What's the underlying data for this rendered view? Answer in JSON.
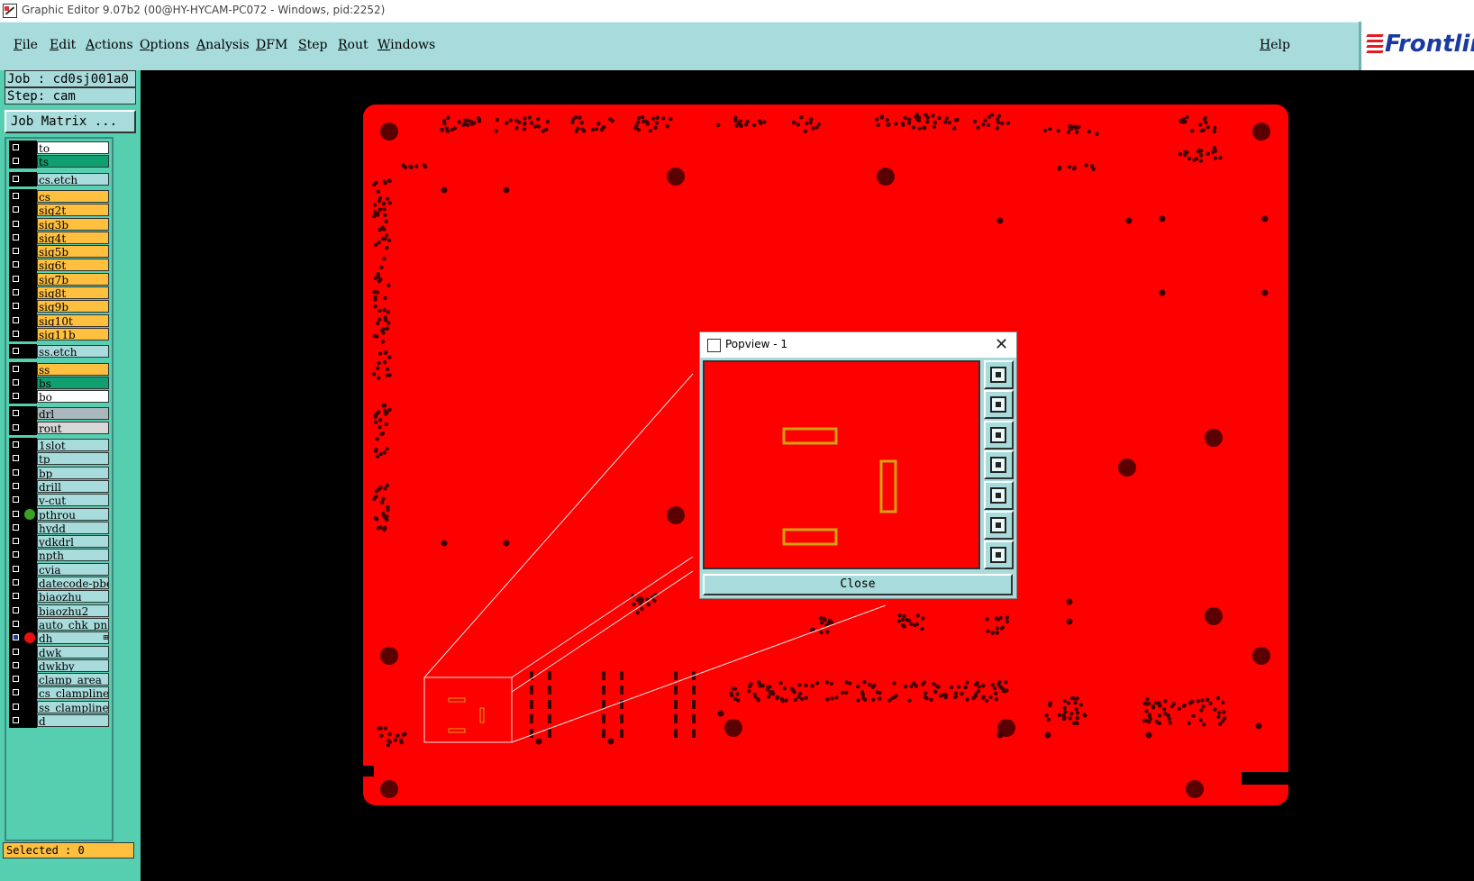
{
  "window": {
    "title": "Graphic Editor 9.07b2 (00@HY-HYCAM-PC072 - Windows, pid:2252)"
  },
  "menu": {
    "items": [
      "File",
      "Edit",
      "Actions",
      "Options",
      "Analysis",
      "DFM",
      "Step",
      "Rout",
      "Windows"
    ],
    "help": "Help"
  },
  "logo": {
    "text": "Frontline"
  },
  "job": {
    "job_label": "Job : cd0sj001a0",
    "step_label": "Step: cam",
    "job_matrix": "Job Matrix ..."
  },
  "layers": [
    {
      "name": "to",
      "color": "#ffffff"
    },
    {
      "name": "ts",
      "color": "#10a070"
    },
    {
      "name": "cs.etch",
      "color": "#a8dcdc"
    },
    {
      "name": "cs",
      "color": "#ffc040"
    },
    {
      "name": "sig2t",
      "color": "#ffc040"
    },
    {
      "name": "sig3b",
      "color": "#ffc040"
    },
    {
      "name": "sig4t",
      "color": "#ffc040"
    },
    {
      "name": "sig5b",
      "color": "#ffc040"
    },
    {
      "name": "sig6t",
      "color": "#ffc040"
    },
    {
      "name": "sig7b",
      "color": "#ffc040"
    },
    {
      "name": "sig8t",
      "color": "#ffc040"
    },
    {
      "name": "sig9b",
      "color": "#ffc040"
    },
    {
      "name": "sig10t",
      "color": "#ffc040"
    },
    {
      "name": "sig11b",
      "color": "#ffc040"
    },
    {
      "name": "ss.etch",
      "color": "#a8dcdc"
    },
    {
      "name": "ss",
      "color": "#ffc040"
    },
    {
      "name": "bs",
      "color": "#10a070"
    },
    {
      "name": "bo",
      "color": "#ffffff"
    },
    {
      "name": "drl",
      "color": "#a8b8bc"
    },
    {
      "name": "rout",
      "color": "#d8d8d8"
    },
    {
      "name": "1slot",
      "color": "#a8dcdc"
    },
    {
      "name": "tp",
      "color": "#a8dcdc"
    },
    {
      "name": "bp",
      "color": "#a8dcdc"
    },
    {
      "name": "drill",
      "color": "#a8dcdc"
    },
    {
      "name": "v-cut",
      "color": "#a8dcdc"
    },
    {
      "name": "pthrou",
      "color": "#a8dcdc",
      "dot": "#3ca020"
    },
    {
      "name": "hydd",
      "color": "#a8dcdc"
    },
    {
      "name": "ydkdrl",
      "color": "#a8dcdc"
    },
    {
      "name": "npth",
      "color": "#a8dcdc"
    },
    {
      "name": "cvia",
      "color": "#a8dcdc"
    },
    {
      "name": "datecode-pbc",
      "color": "#a8dcdc"
    },
    {
      "name": "biaozhu",
      "color": "#a8dcdc"
    },
    {
      "name": "biaozhu2",
      "color": "#a8dcdc"
    },
    {
      "name": "auto_chk_pn",
      "color": "#a8dcdc"
    },
    {
      "name": "dh",
      "color": "#a8dcdc",
      "dot": "#e81010",
      "selected": true,
      "mark": "⊞"
    },
    {
      "name": "dwk",
      "color": "#a8dcdc"
    },
    {
      "name": "dwkby",
      "color": "#a8dcdc"
    },
    {
      "name": "clamp_area",
      "color": "#a8dcdc"
    },
    {
      "name": "cs_clampline",
      "color": "#a8dcdc"
    },
    {
      "name": "ss_clampline",
      "color": "#a8dcdc"
    },
    {
      "name": "d",
      "color": "#a8dcdc"
    }
  ],
  "status": {
    "selected": "Selected : 0"
  },
  "popview": {
    "title": "Popview - 1",
    "close_label": "Close",
    "tool_icons": [
      "zoom-window-icon",
      "pan-up-icon",
      "pan-down-icon",
      "pan-left-icon",
      "pan-right-icon",
      "zoom-in-icon",
      "zoom-out-icon"
    ]
  },
  "colors": {
    "board": "#ff0000",
    "pad_outline": "#d4a010",
    "panel": "#55cfb0",
    "menu": "#a8dcdc"
  }
}
